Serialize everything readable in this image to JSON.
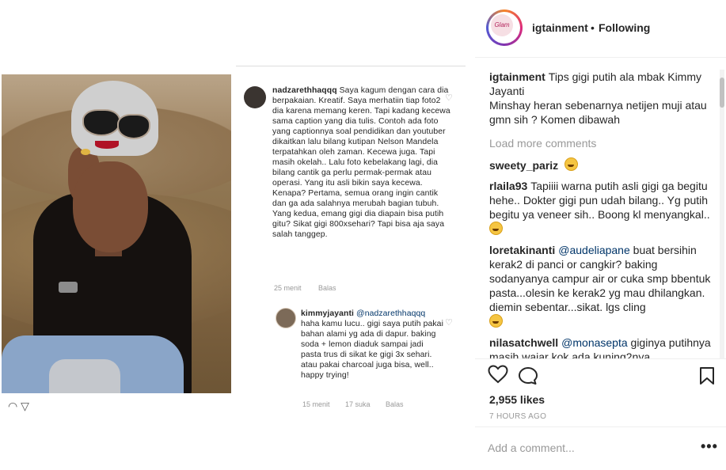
{
  "post_image": {
    "screenshot": {
      "comment1": {
        "user": "nadzarethhaqqq",
        "text": "Saya kagum dengan cara dia berpakaian. Kreatif. Saya merhatiin tiap foto2 dia karena memang keren. Tapi kadang kecewa sama caption yang dia tulis. Contoh ada foto yang captionnya soal pendidikan dan youtuber dikaitkan lalu bilang kutipan Nelson Mandela terpatahkan oleh zaman. Kecewa juga. Tapi masih okelah.. Lalu foto kebelakang lagi, dia bilang cantik ga perlu permak-permak atau operasi. Yang itu asli bikin saya kecewa. Kenapa? Pertama, semua orang ingin cantik dan ga ada salahnya merubah bagian tubuh. Yang kedua, emang gigi dia diapain bisa putih gitu? Sikat gigi 800xsehari? Tapi bisa aja saya salah tanggep.",
        "time": "25 menit",
        "reply": "Balas"
      },
      "comment2": {
        "user": "kimmyjayanti",
        "mention": "@nadzarethhaqqq",
        "text": "haha kamu lucu.. gigi saya putih pakai bahan alami yg ada di dapur. baking soda + lemon diaduk sampai jadi pasta trus di sikat ke gigi 3x sehari. atau pakai charcoal juga bisa, well.. happy trying!",
        "time": "15 menit",
        "likes": "17 suka",
        "reply": "Balas"
      }
    }
  },
  "header": {
    "username": "igtainment",
    "separator": "•",
    "follow_status": "Following",
    "avatar_text": "Glam"
  },
  "caption": {
    "user": "igtainment",
    "text": "Tips gigi putih ala mbak Kimmy Jayanti",
    "text2": "Minshay heran sebenarnya netijen muji atau gmn sih ? Komen dibawah"
  },
  "load_more": "Load more comments",
  "comments": [
    {
      "user": "sweety_pariz",
      "text": ""
    },
    {
      "user": "rlaila93",
      "text": "Tapiiii warna putih asli gigi ga begitu hehe.. Dokter gigi pun udah bilang.. Yg putih begitu ya veneer sih.. Boong kl menyangkal.."
    },
    {
      "user": "loretakinanti",
      "mention": "@audeliapane",
      "text": "buat bersihin kerak2 di panci or cangkir? baking sodanyanya campur air or cuka smp bbentuk pasta...olesin ke kerak2 yg mau dhilangkan. diemin sebentar...sikat. lgs cling"
    },
    {
      "user": "nilasatchwell",
      "mention": "@monasepta",
      "text": "giginya putihnya masih wajar kok ada kuning2nya"
    }
  ],
  "actions": {
    "likes": "2,955 likes",
    "time": "7 HOURS AGO",
    "comment_placeholder": "Add a comment...",
    "more": "•••"
  }
}
